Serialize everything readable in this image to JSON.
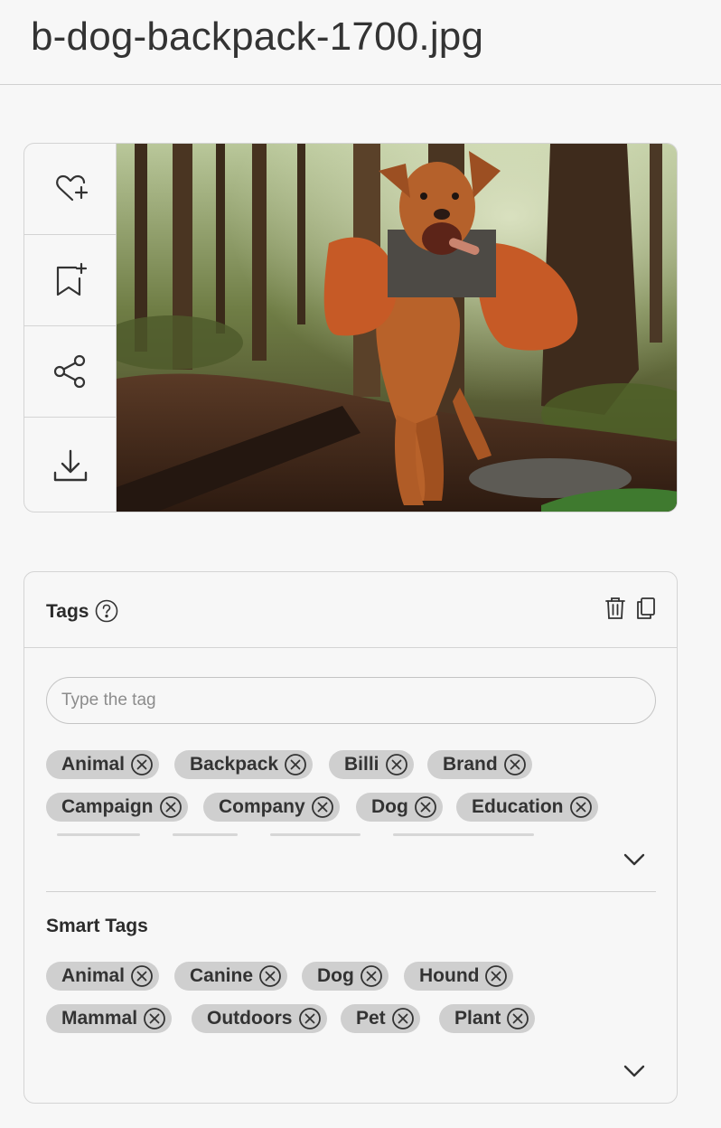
{
  "file": {
    "title": "b-dog-backpack-1700.jpg"
  },
  "actions": [
    {
      "name": "favorite",
      "icon": "heart-plus-icon"
    },
    {
      "name": "collection",
      "icon": "bookmark-plus-icon"
    },
    {
      "name": "share",
      "icon": "share-icon"
    },
    {
      "name": "download",
      "icon": "download-icon"
    }
  ],
  "tags": {
    "title": "Tags",
    "input_placeholder": "Type the tag",
    "items": [
      "Animal",
      "Backpack",
      "Billi",
      "Brand",
      "Campaign",
      "Company",
      "Dog",
      "Education"
    ]
  },
  "smart_tags": {
    "title": "Smart Tags",
    "items": [
      "Animal",
      "Canine",
      "Dog",
      "Hound",
      "Mammal",
      "Outdoors",
      "Pet",
      "Plant"
    ]
  },
  "colors": {
    "chip_bg": "#cfcfcf",
    "text": "#2b2b2b",
    "border": "#d4d4d4"
  }
}
